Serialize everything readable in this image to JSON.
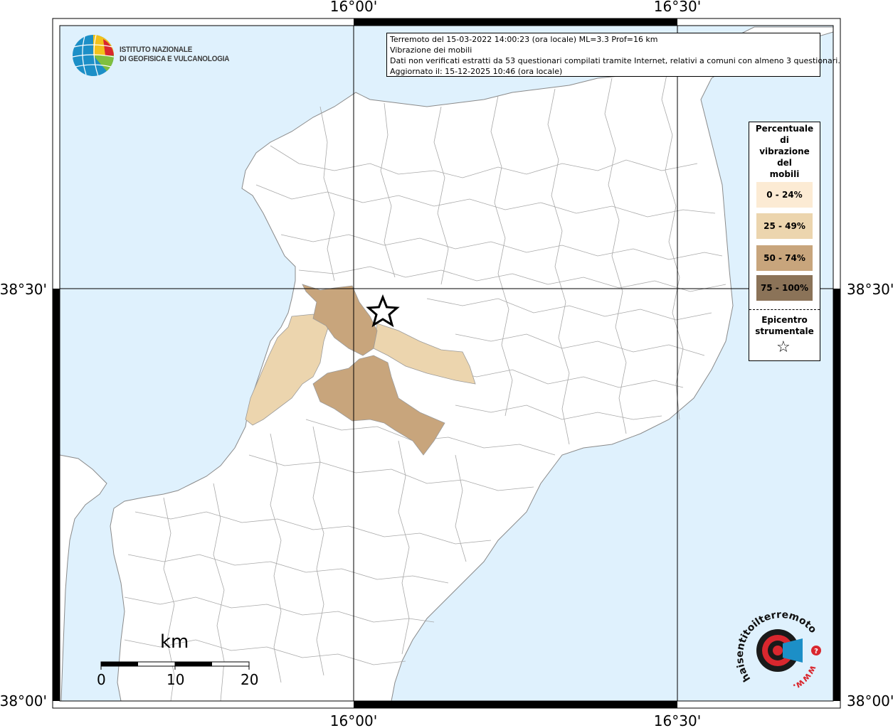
{
  "map": {
    "lon_labels": [
      "16°00'",
      "16°30'"
    ],
    "lat_labels": [
      "38°30'",
      "38°00'"
    ]
  },
  "info": {
    "line1": "Terremoto del 15-03-2022 14:00:23 (ora locale) ML=3.3 Prof=16 km",
    "line2": "Vibrazione dei mobili",
    "line3": "Dati non verificati estratti da 53 questionari compilati tramite Internet, relativi a comuni con almeno 3 questionari.",
    "line4": "Aggiornato il: 15-12-2025 10:46 (ora locale)"
  },
  "logo": {
    "line1": "ISTITUTO NAZIONALE",
    "line2": "DI GEOFISICA E VULCANOLOGIA"
  },
  "legend": {
    "title": [
      "Percentuale",
      "di",
      "vibrazione",
      "del",
      "mobili"
    ],
    "items": [
      {
        "label": "0 - 24%",
        "color": "#fcebd4"
      },
      {
        "label": "25 - 49%",
        "color": "#ecd5ae"
      },
      {
        "label": "50 - 74%",
        "color": "#c8a57c"
      },
      {
        "label": "75 - 100%",
        "color": "#8b7358"
      }
    ],
    "epicenter": [
      "Epicentro",
      "strumentale"
    ],
    "epicenter_symbol": "☆"
  },
  "scale": {
    "unit": "km",
    "labels": [
      "0",
      "10",
      "20"
    ]
  },
  "brand": {
    "text": "haisentitoilterremoto.it",
    "prefix": "www."
  },
  "colors": {
    "sea": "#dff1fd",
    "land": "#ffffff",
    "boundary": "#a8a8a8"
  }
}
